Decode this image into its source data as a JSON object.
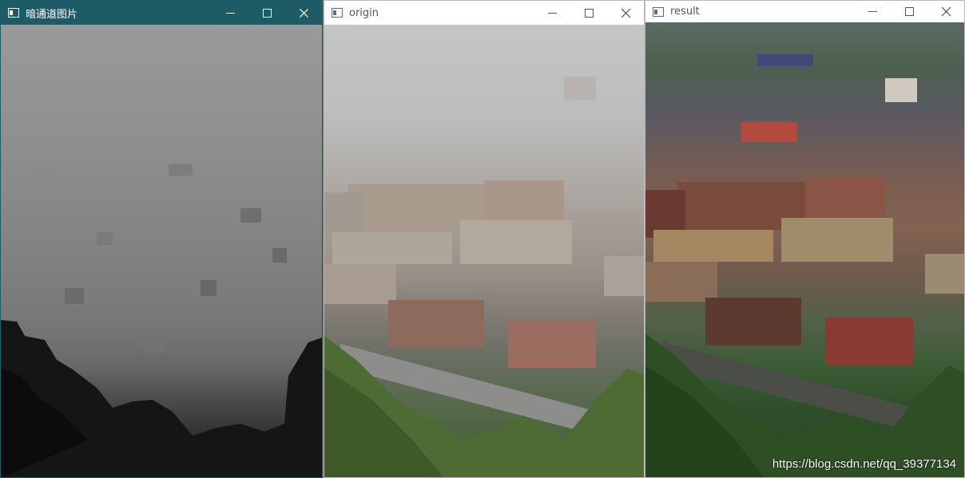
{
  "windows": {
    "dark": {
      "title": "暗通道图片",
      "titlebar_color": "#1d5b66"
    },
    "origin": {
      "title": "origin"
    },
    "result": {
      "title": "result",
      "watermark": "https://blog.csdn.net/qq_39377134"
    }
  },
  "icons": {
    "app": "window-app-icon",
    "minimize": "minimize-icon",
    "maximize": "maximize-icon",
    "close": "close-icon"
  }
}
